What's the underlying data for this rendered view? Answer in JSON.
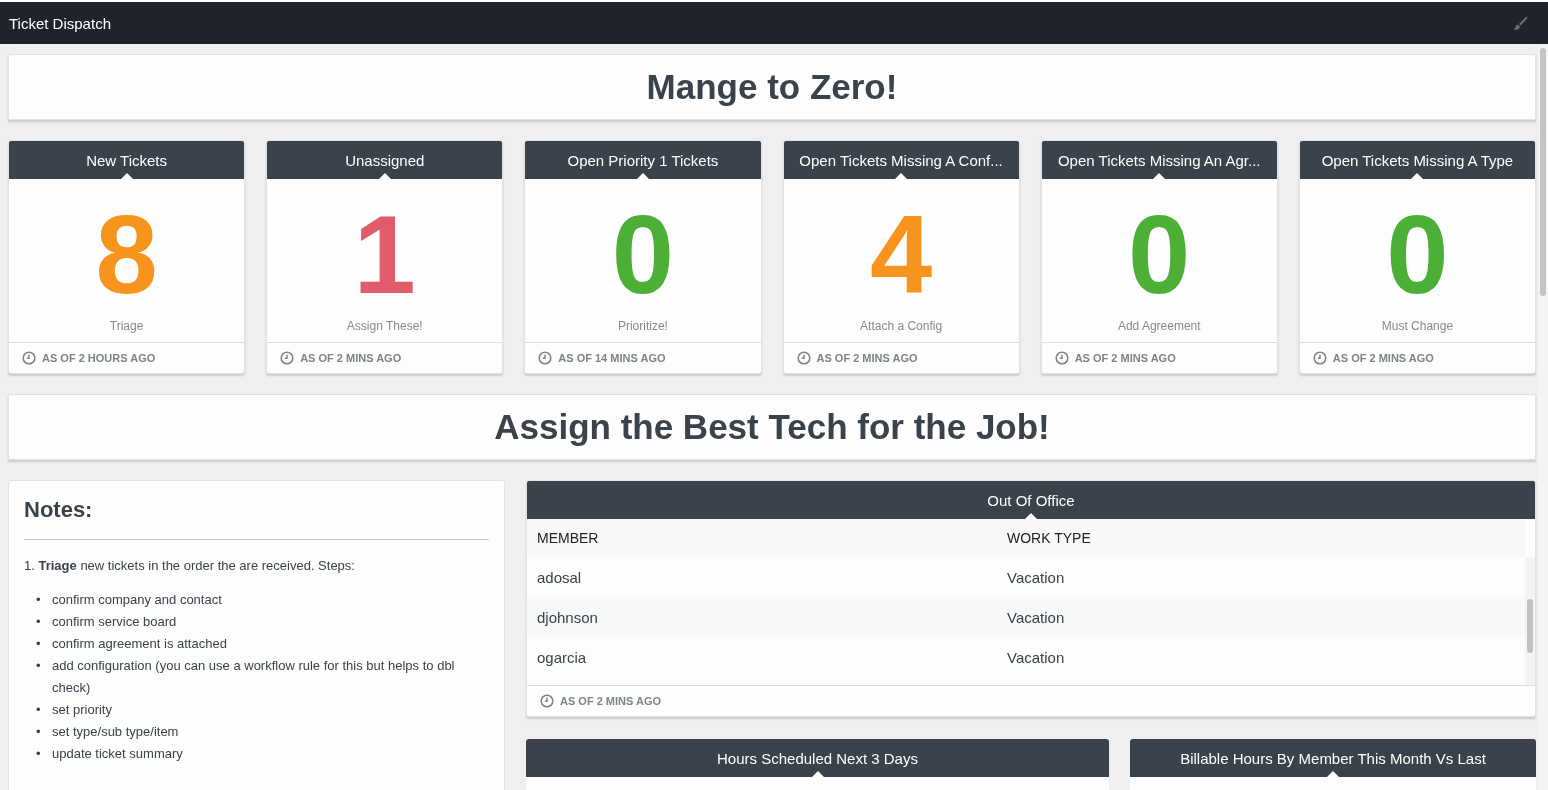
{
  "window": {
    "title": "Ticket Dispatch"
  },
  "banner_1": {
    "title": "Mange to Zero!"
  },
  "metrics": [
    {
      "title": "New Tickets",
      "value": "8",
      "color": "#f7941d",
      "caption": "Triage",
      "updated": "AS OF 2 HOURS AGO"
    },
    {
      "title": "Unassigned",
      "value": "1",
      "color": "#e05c6b",
      "caption": "Assign These!",
      "updated": "AS OF 2 MINS AGO"
    },
    {
      "title": "Open Priority 1 Tickets",
      "value": "0",
      "color": "#4caf36",
      "caption": "Prioritize!",
      "updated": "AS OF 14 MINS AGO"
    },
    {
      "title": "Open Tickets Missing A Conf...",
      "value": "4",
      "color": "#f7941d",
      "caption": "Attach a Config",
      "updated": "AS OF 2 MINS AGO"
    },
    {
      "title": "Open Tickets Missing An Agr...",
      "value": "0",
      "color": "#4caf36",
      "caption": "Add Agreement",
      "updated": "AS OF 2 MINS AGO"
    },
    {
      "title": "Open Tickets Missing A Type",
      "value": "0",
      "color": "#4caf36",
      "caption": "Must Change",
      "updated": "AS OF 2 MINS AGO"
    }
  ],
  "banner_2": {
    "title": "Assign the Best Tech for the Job!"
  },
  "notes": {
    "title": "Notes:",
    "intro": "1. **Triage** new tickets in the order the are received. Steps:",
    "steps": [
      {
        "bullet": "•",
        "text": "confirm company and contact"
      },
      {
        "bullet": "•",
        "text": "confirm service board"
      },
      {
        "bullet": "•",
        "text": "confirm agreement is attached"
      },
      {
        "bullet": "•",
        "text": "add configuration (you can use a workflow rule for this but helps to dbl check)"
      },
      {
        "bullet": "•",
        "text": "set priority"
      },
      {
        "bullet": "•",
        "text": "set type/sub type/item"
      },
      {
        "bullet": "•",
        "text": "update ticket summary"
      }
    ]
  },
  "out_of_office": {
    "title": "Out Of Office",
    "columns": [
      "MEMBER",
      "WORK TYPE"
    ],
    "rows": [
      [
        "adosal",
        "Vacation"
      ],
      [
        "djohnson",
        "Vacation"
      ],
      [
        "ogarcia",
        "Vacation"
      ]
    ],
    "updated": "AS OF 2 MINS AGO"
  },
  "bottom_widgets": [
    {
      "title": "Hours Scheduled Next 3 Days"
    },
    {
      "title": "Billable Hours By Member This Month Vs Last"
    }
  ]
}
